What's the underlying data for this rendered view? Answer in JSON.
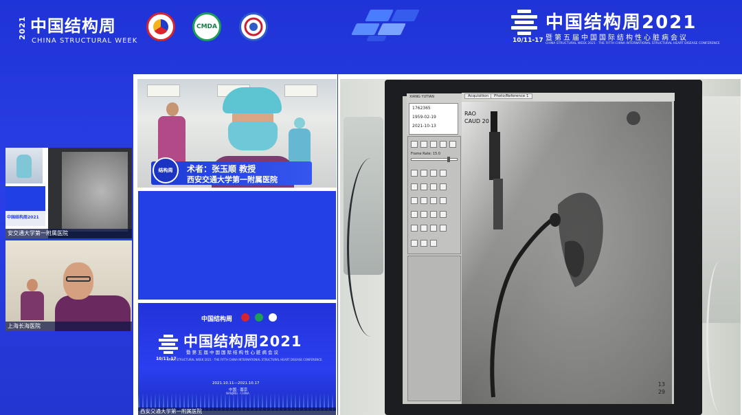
{
  "header": {
    "year_vertical": "2021",
    "title_cn": "中国结构周",
    "title_en": "CHINA STRUCTURAL WEEK",
    "logos": [
      "society-logo",
      "CMDA",
      "CAPCCI"
    ],
    "right": {
      "title_cn": "中国结构周",
      "year": "2021",
      "subtitle_cn": "暨第五届中国国际结构性心脏病会议",
      "dates": "10/11-17",
      "subtitle_en": "CHINA STRUCTURAL WEEK 2021 · THE FIFTH CHINA INTERNATIONAL STRUCTURAL HEART DISEASE CONFERENCE"
    }
  },
  "left_panels": {
    "top": {
      "caption": "安交通大学第一附属医院",
      "mini_logo": "中国结构周2021"
    },
    "bottom": {
      "caption": "上海长海医院"
    }
  },
  "center": {
    "camera": {
      "badge": "结构周",
      "surgeon": "术者：张玉顺 教授",
      "institution": "西安交通大学第一附属医院"
    },
    "slide": {
      "header": "中国结构周",
      "title": "中国结构周2021",
      "subtitle": "暨第五届中国国际结构性心脏病会议",
      "dates_mark": "10/11-17",
      "subtitle_en": "CHINA STRUCTURAL WEEK 2021 · THE FIFTH CHINA INTERNATIONAL STRUCTURAL HEART DISEASE CONFERENCE",
      "date_range": "2021.10.11—2021.10.17",
      "location": "中国 · 南京",
      "location_en": "NANJING · CHINA"
    },
    "caption": "西安交通大学第一附属医院"
  },
  "monitor": {
    "patient_name": "XIANG YUTIAN",
    "info_lines": [
      "1762365",
      "1959-02-19",
      "2021-10-13"
    ],
    "tabs": [
      "Acquisition",
      "Photo/Reference 1"
    ],
    "zoom_label": "Frame Rate: 15.0",
    "angle_lines": [
      "RAO",
      "CAUD 20"
    ],
    "frame_counter": [
      "13",
      "29"
    ]
  },
  "colors": {
    "background": "#2236d6",
    "panel_blue": "#233fe6",
    "accent_red": "#d8242c",
    "accent_green": "#1f9e58"
  }
}
